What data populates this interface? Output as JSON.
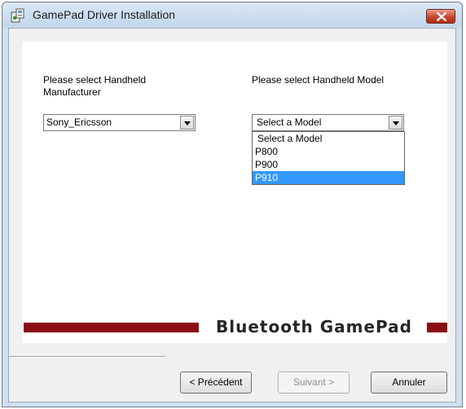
{
  "window": {
    "title": "GamePad Driver Installation"
  },
  "manufacturer": {
    "label": "Please select Handheld Manufacturer",
    "selected": "Sony_Ericsson"
  },
  "model": {
    "label": "Please select Handheld Model",
    "selected": "Select a Model",
    "options": [
      "Select a Model",
      "P800",
      "P900",
      "P910"
    ],
    "highlighted": "P910"
  },
  "banner": {
    "text": "Bluetooth GamePad",
    "color": "#8b0e15"
  },
  "buttons": {
    "back": "< Précédent",
    "next": "Suivant >",
    "cancel": "Annuler"
  },
  "colors": {
    "selection": "#3399ff",
    "close_button": "#c7442d"
  }
}
